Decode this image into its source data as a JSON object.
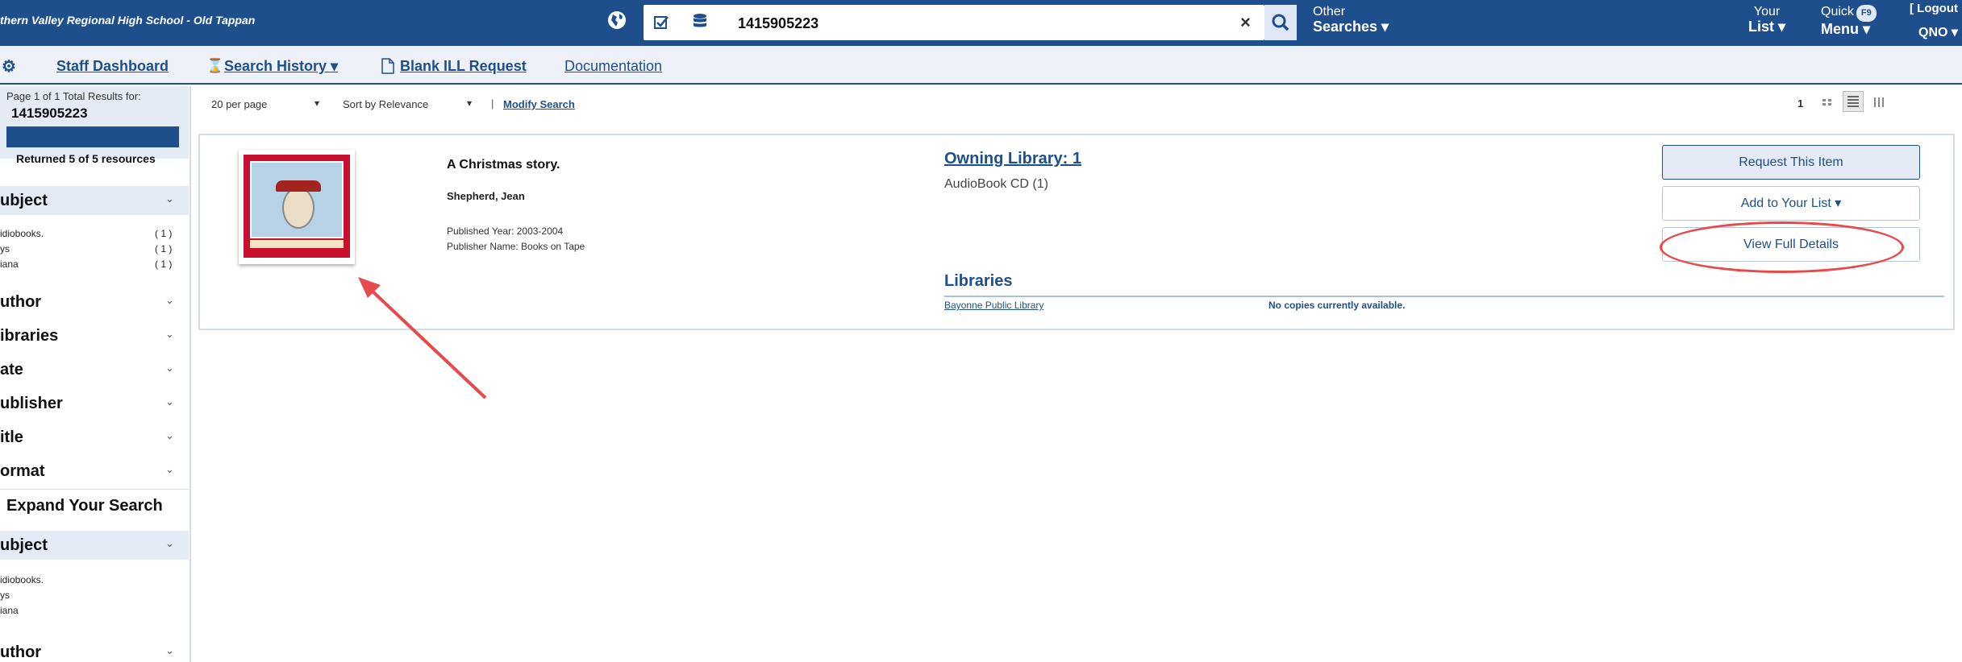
{
  "header": {
    "school": "thern Valley Regional High School - Old Tappan",
    "search_value": "1415905223",
    "clear_glyph": "×",
    "other_line1": "Other",
    "other_line2": "Searches ▾",
    "your_list_line1": "Your",
    "your_list_line2": "List ▾",
    "quick_line1": "Quick",
    "quick_badge": "F9",
    "quick_line2": "Menu ▾",
    "logout": "[ Logout",
    "user": "QNO ▾"
  },
  "nav": {
    "staff_dashboard": "Staff Dashboard",
    "search_history": "Search History ▾",
    "blank_ill": "Blank ILL Request",
    "documentation": "Documentation"
  },
  "sidebar": {
    "page_info": "Page 1 of 1 Total Results for:",
    "query": "1415905223",
    "returned": "Returned 5 of 5 resources",
    "facets_top": [
      {
        "label": "ubject",
        "chevron": "⌄"
      },
      {
        "label": "uthor",
        "chevron": "⌄"
      },
      {
        "label": "ibraries",
        "chevron": "⌄"
      },
      {
        "label": "ate",
        "chevron": "⌄"
      },
      {
        "label": "ublisher",
        "chevron": "⌄"
      },
      {
        "label": "itle",
        "chevron": "⌄"
      },
      {
        "label": "ormat",
        "chevron": "⌄"
      }
    ],
    "subject_items": [
      {
        "label": "idiobooks.",
        "count": "( 1 )"
      },
      {
        "label": "ys",
        "count": "( 1 )"
      },
      {
        "label": "iana",
        "count": "( 1 )"
      }
    ],
    "expand_title": "Expand Your Search",
    "facets_bottom": [
      {
        "label": "ubject",
        "chevron": "⌄"
      },
      {
        "label": "uthor",
        "chevron": "⌄"
      }
    ],
    "expand_items": [
      "idiobooks.",
      "ys",
      "iana"
    ]
  },
  "toolbar": {
    "per_page": "20 per page",
    "sort": "Sort by Relevance",
    "caret": "▾",
    "separator": "|",
    "modify": "Modify Search",
    "page": "1"
  },
  "result": {
    "title": "A Christmas story.",
    "author": "Shepherd, Jean",
    "published_year": "Published Year: 2003-2004",
    "publisher": "Publisher Name: Books on Tape",
    "owning_library": "Owning Library: 1",
    "format": "AudioBook CD (1)",
    "libraries_heading": "Libraries",
    "library_name": "Bayonne Public Library",
    "library_status": "No copies currently available.",
    "btn_request": "Request This Item",
    "btn_add": "Add to Your List ▾",
    "btn_details": "View Full Details"
  },
  "colors": {
    "brand": "#1e4f8c",
    "annotation": "#e74a4a"
  }
}
